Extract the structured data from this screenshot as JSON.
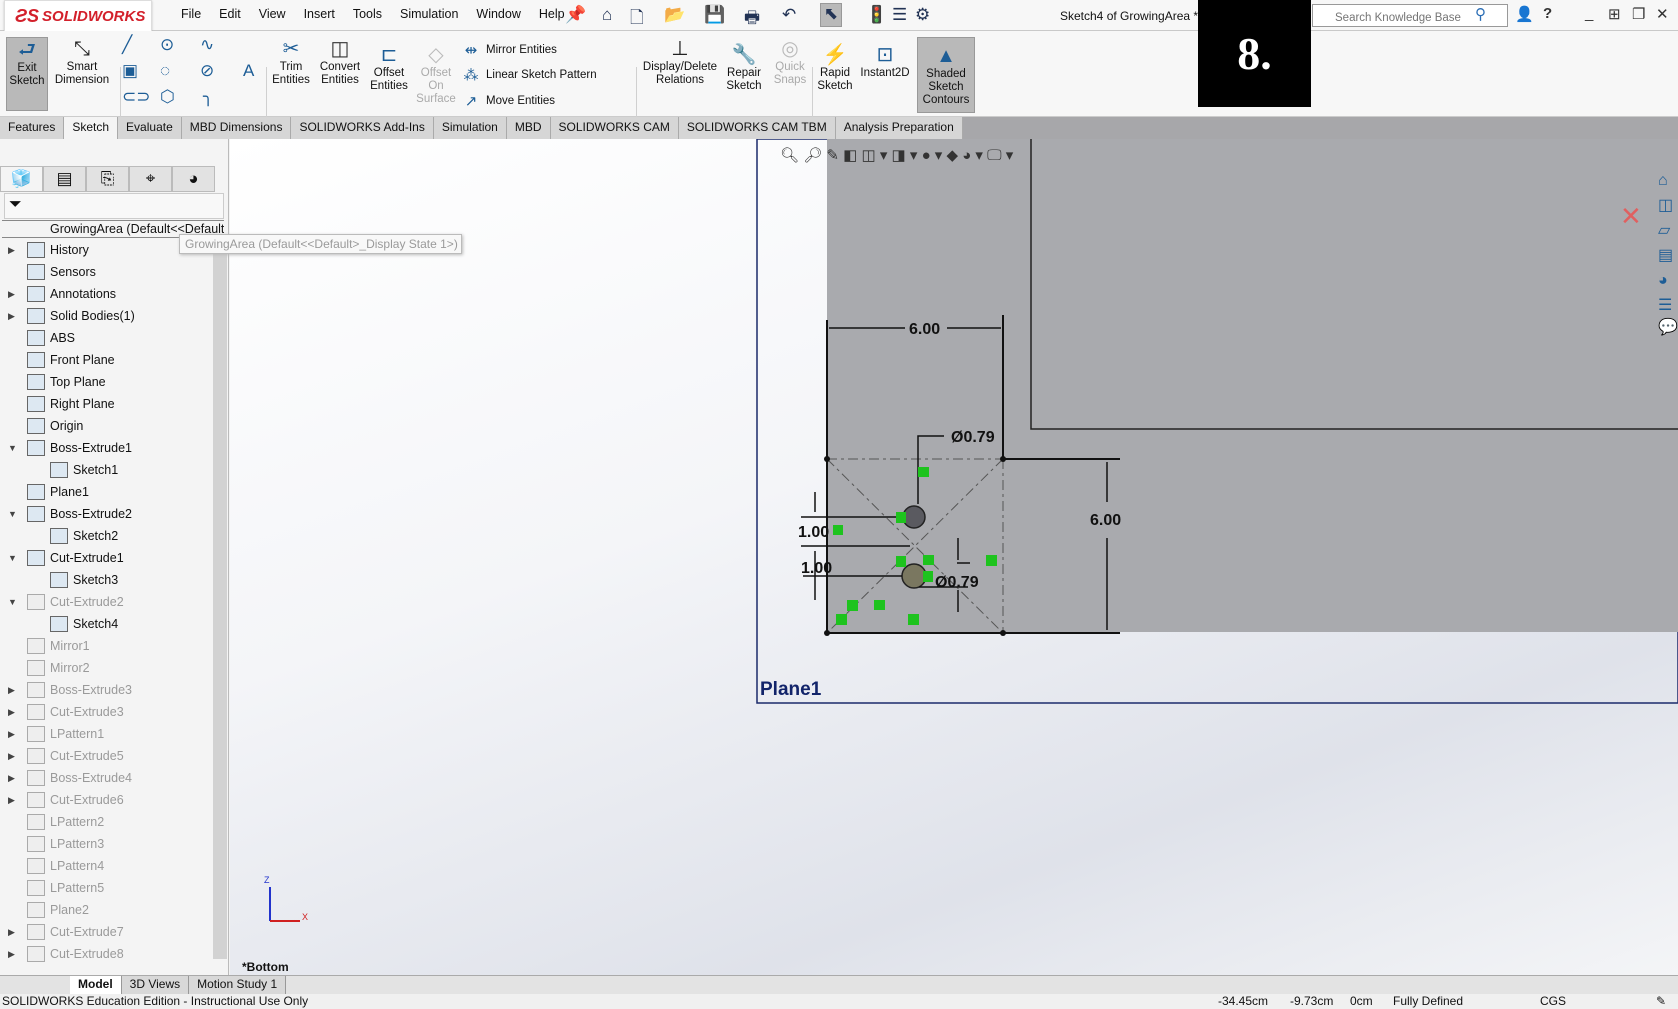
{
  "app": {
    "brand": "SOLIDWORKS",
    "doc_title": "Sketch4 of GrowingArea *",
    "step_badge": "8."
  },
  "menu": [
    "File",
    "Edit",
    "View",
    "Insert",
    "Tools",
    "Simulation",
    "Window",
    "Help"
  ],
  "search": {
    "placeholder": "Search Knowledge Base"
  },
  "ribbon": {
    "exit_sketch": "Exit Sketch",
    "smart_dimension": "Smart Dimension",
    "trim": "Trim Entities",
    "convert": "Convert Entities",
    "offset": "Offset Entities",
    "offset_surface": "Offset On Surface",
    "mirror": "Mirror Entities",
    "linear_pattern": "Linear Sketch Pattern",
    "move": "Move Entities",
    "display_delete": "Display/Delete Relations",
    "repair": "Repair Sketch",
    "quick_snaps": "Quick Snaps",
    "rapid": "Rapid Sketch",
    "instant2d": "Instant2D",
    "shaded": "Shaded Sketch Contours"
  },
  "tabs": [
    "Features",
    "Sketch",
    "Evaluate",
    "MBD Dimensions",
    "SOLIDWORKS Add-Ins",
    "Simulation",
    "MBD",
    "SOLIDWORKS CAM",
    "SOLIDWORKS CAM TBM",
    "Analysis Preparation"
  ],
  "active_tab": "Sketch",
  "tree": {
    "root": "GrowingArea  (Default<<Default>_Display State 1>)",
    "tooltip": "GrowingArea  (Default<<Default>_Display State 1>)",
    "items": [
      {
        "label": "History",
        "indent": 0,
        "exp": "right",
        "sup": false
      },
      {
        "label": "Sensors",
        "indent": 0,
        "exp": "",
        "sup": false
      },
      {
        "label": "Annotations",
        "indent": 0,
        "exp": "right",
        "sup": false
      },
      {
        "label": "Solid Bodies(1)",
        "indent": 0,
        "exp": "right",
        "sup": false
      },
      {
        "label": "ABS",
        "indent": 0,
        "exp": "",
        "sup": false
      },
      {
        "label": "Front Plane",
        "indent": 0,
        "exp": "",
        "sup": false
      },
      {
        "label": "Top Plane",
        "indent": 0,
        "exp": "",
        "sup": false
      },
      {
        "label": "Right Plane",
        "indent": 0,
        "exp": "",
        "sup": false
      },
      {
        "label": "Origin",
        "indent": 0,
        "exp": "",
        "sup": false
      },
      {
        "label": "Boss-Extrude1",
        "indent": 0,
        "exp": "down",
        "sup": false
      },
      {
        "label": "Sketch1",
        "indent": 1,
        "exp": "",
        "sup": false
      },
      {
        "label": "Plane1",
        "indent": 0,
        "exp": "",
        "sup": false
      },
      {
        "label": "Boss-Extrude2",
        "indent": 0,
        "exp": "down",
        "sup": false
      },
      {
        "label": "Sketch2",
        "indent": 1,
        "exp": "",
        "sup": false
      },
      {
        "label": "Cut-Extrude1",
        "indent": 0,
        "exp": "down",
        "sup": false
      },
      {
        "label": "Sketch3",
        "indent": 1,
        "exp": "",
        "sup": false
      },
      {
        "label": "Cut-Extrude2",
        "indent": 0,
        "exp": "down",
        "sup": true
      },
      {
        "label": "Sketch4",
        "indent": 1,
        "exp": "",
        "sup": false
      },
      {
        "label": "Mirror1",
        "indent": 0,
        "exp": "",
        "sup": true
      },
      {
        "label": "Mirror2",
        "indent": 0,
        "exp": "",
        "sup": true
      },
      {
        "label": "Boss-Extrude3",
        "indent": 0,
        "exp": "right",
        "sup": true
      },
      {
        "label": "Cut-Extrude3",
        "indent": 0,
        "exp": "right",
        "sup": true
      },
      {
        "label": "LPattern1",
        "indent": 0,
        "exp": "right",
        "sup": true
      },
      {
        "label": "Cut-Extrude5",
        "indent": 0,
        "exp": "right",
        "sup": true
      },
      {
        "label": "Boss-Extrude4",
        "indent": 0,
        "exp": "right",
        "sup": true
      },
      {
        "label": "Cut-Extrude6",
        "indent": 0,
        "exp": "right",
        "sup": true
      },
      {
        "label": "LPattern2",
        "indent": 0,
        "exp": "",
        "sup": true
      },
      {
        "label": "LPattern3",
        "indent": 0,
        "exp": "",
        "sup": true
      },
      {
        "label": "LPattern4",
        "indent": 0,
        "exp": "",
        "sup": true
      },
      {
        "label": "LPattern5",
        "indent": 0,
        "exp": "",
        "sup": true
      },
      {
        "label": "Plane2",
        "indent": 0,
        "exp": "",
        "sup": true
      },
      {
        "label": "Cut-Extrude7",
        "indent": 0,
        "exp": "right",
        "sup": true
      },
      {
        "label": "Cut-Extrude8",
        "indent": 0,
        "exp": "right",
        "sup": true
      }
    ]
  },
  "sketch": {
    "dim_width": "6.00",
    "dim_height": "6.00",
    "dim_hole1": "Ø0.79",
    "dim_hole2": "Ø0.79",
    "dim_off1": "1.00",
    "dim_off2": "1.00",
    "plane_label": "Plane1",
    "view_label": "*Bottom",
    "axis_x": "X",
    "axis_y": "Z",
    "part_color": "#a9aaae",
    "relation_color": "#1ec31e"
  },
  "bottom_tabs": [
    "Model",
    "3D Views",
    "Motion Study 1"
  ],
  "status": {
    "edition": "SOLIDWORKS Education Edition - Instructional Use Only",
    "x": "-34.45cm",
    "y": "-9.73cm",
    "z": "0cm",
    "state": "Fully Defined",
    "units": "CGS"
  }
}
